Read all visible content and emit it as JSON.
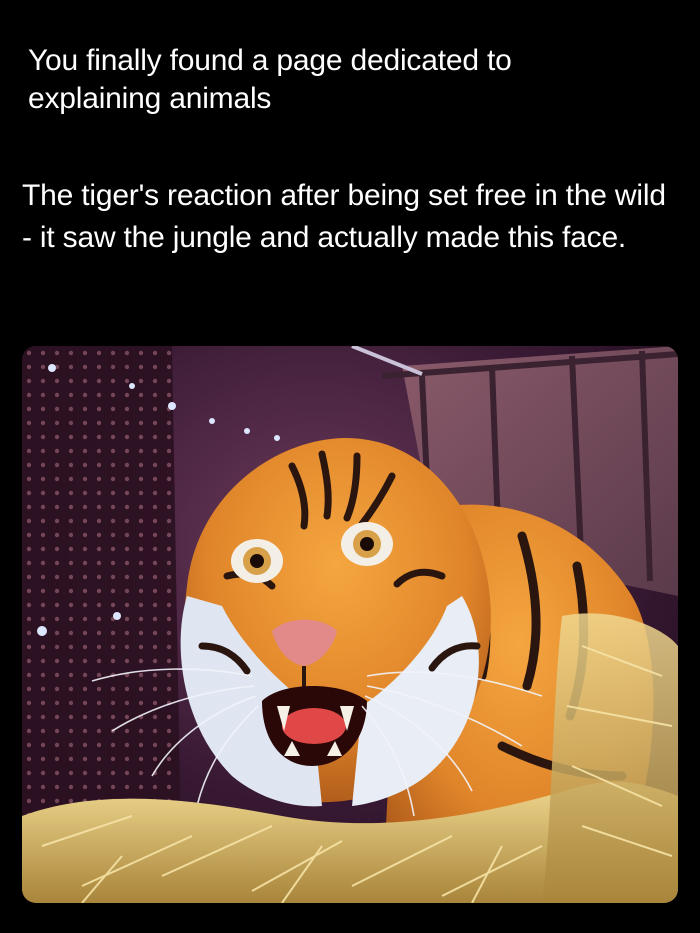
{
  "post": {
    "intro_text": "You finally found a page dedicated to explaining animals",
    "body_text": "The tiger's reaction after being set free in the wild - it saw the jungle and actually made this face."
  },
  "media": {
    "subject": "tiger-in-crate-photo",
    "colors": {
      "page_background": "#000000",
      "text": "#ffffff",
      "fur_orange": "#e0852a",
      "fur_white": "#dfe6f2",
      "crate_purple": "#3a1a35",
      "straw": "#d8b86a"
    }
  }
}
